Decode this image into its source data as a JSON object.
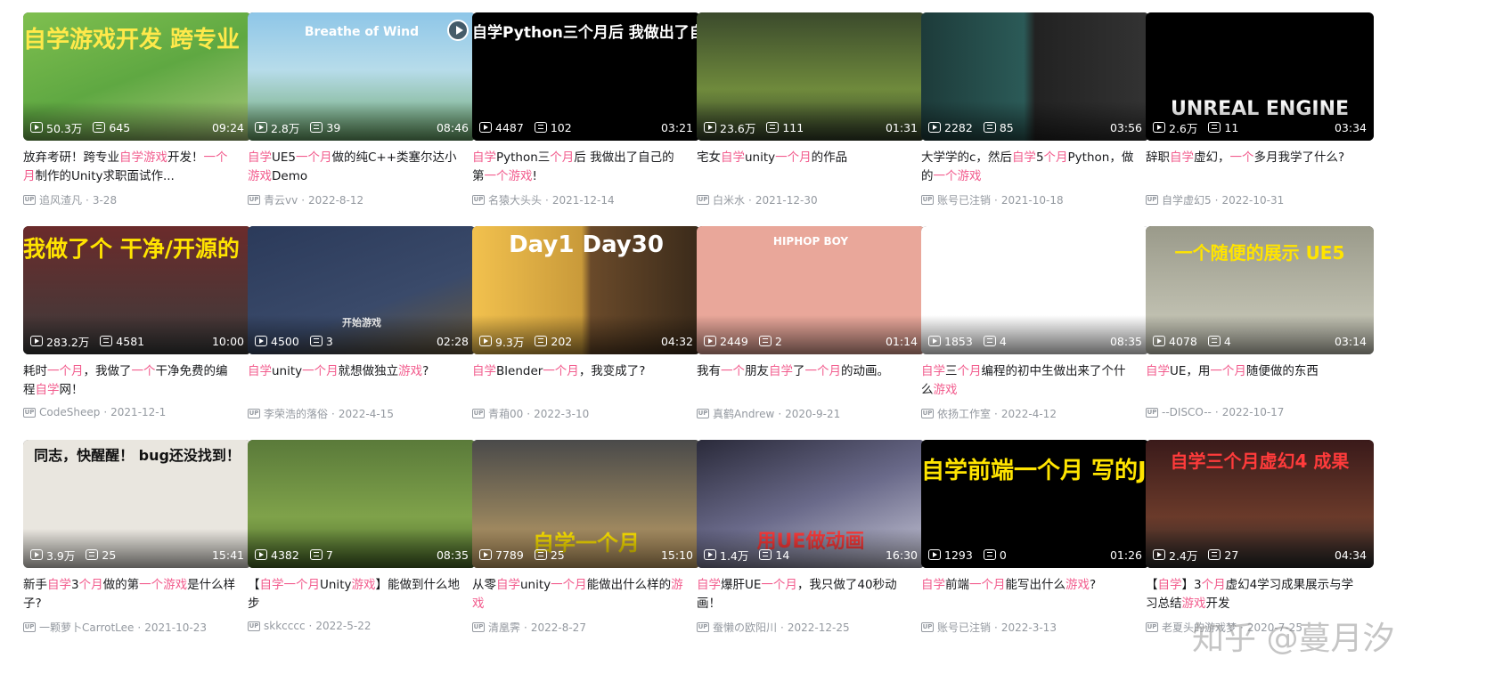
{
  "colors": {
    "highlight": "#f25d8e",
    "meta": "#9499a0",
    "title": "#18191c"
  },
  "icons": {
    "views": "play-count-icon",
    "danmaku": "danmaku-count-icon",
    "uploader": "up-badge-icon",
    "corner": "play-circle-icon"
  },
  "up_badge": "UP",
  "watermark": "知乎 @蔓月汐",
  "videos": [
    {
      "thumb_text": "自学游戏开发 跨专业 求职作品",
      "views": "50.3万",
      "danmaku": "645",
      "duration": "09:24",
      "title": [
        {
          "t": "放弃考研！跨专业"
        },
        {
          "t": "自学游戏",
          "hl": true
        },
        {
          "t": "开发！"
        },
        {
          "t": "一个月",
          "hl": true
        },
        {
          "t": "制作的Unity求职面试作..."
        }
      ],
      "uploader": "追风渣凡",
      "date": "3-28"
    },
    {
      "thumb_text": "Breathe of Wind",
      "views": "2.8万",
      "danmaku": "39",
      "duration": "08:46",
      "title": [
        {
          "t": "自学",
          "hl": true
        },
        {
          "t": "UE5"
        },
        {
          "t": "一个月",
          "hl": true
        },
        {
          "t": "做的纯C++类塞尔达小"
        },
        {
          "t": "游戏",
          "hl": true
        },
        {
          "t": "Demo"
        }
      ],
      "uploader": "青云vv",
      "date": "2022-8-12"
    },
    {
      "thumb_text": "自学Python三个月后 我做出了自己的第一个游戏",
      "views": "4487",
      "danmaku": "102",
      "duration": "03:21",
      "title": [
        {
          "t": "自学",
          "hl": true
        },
        {
          "t": "Python三"
        },
        {
          "t": "个月",
          "hl": true
        },
        {
          "t": "后 我做出了自己的第"
        },
        {
          "t": "一个游戏",
          "hl": true
        },
        {
          "t": "!"
        }
      ],
      "uploader": "名猿大头头",
      "date": "2021-12-14"
    },
    {
      "thumb_text": "",
      "views": "23.6万",
      "danmaku": "111",
      "duration": "01:31",
      "title": [
        {
          "t": "宅女"
        },
        {
          "t": "自学",
          "hl": true
        },
        {
          "t": "unity"
        },
        {
          "t": "一个月",
          "hl": true
        },
        {
          "t": "的作品"
        }
      ],
      "uploader": "白米水",
      "date": "2021-12-30"
    },
    {
      "thumb_text": "",
      "views": "2282",
      "danmaku": "85",
      "duration": "03:56",
      "title": [
        {
          "t": "大学学的c，然后"
        },
        {
          "t": "自学",
          "hl": true
        },
        {
          "t": "5"
        },
        {
          "t": "个月",
          "hl": true
        },
        {
          "t": "Python，做的"
        },
        {
          "t": "一个游戏",
          "hl": true
        }
      ],
      "uploader": "账号已注销",
      "date": "2021-10-18"
    },
    {
      "thumb_text": "UNREAL ENGINE",
      "views": "2.6万",
      "danmaku": "11",
      "duration": "03:34",
      "title": [
        {
          "t": "辞职"
        },
        {
          "t": "自学",
          "hl": true
        },
        {
          "t": "虚幻，"
        },
        {
          "t": "一个",
          "hl": true
        },
        {
          "t": "多月我学了什么?"
        }
      ],
      "uploader": "自学虚幻5",
      "date": "2022-10-31"
    },
    {
      "thumb_text": "我做了个 干净/开源的 编程自学网",
      "views": "283.2万",
      "danmaku": "4581",
      "duration": "10:00",
      "title": [
        {
          "t": "耗时"
        },
        {
          "t": "一个月",
          "hl": true
        },
        {
          "t": "，我做了"
        },
        {
          "t": "一个",
          "hl": true
        },
        {
          "t": "干净免费的编程"
        },
        {
          "t": "自学",
          "hl": true
        },
        {
          "t": "网！"
        }
      ],
      "uploader": "CodeSheep",
      "date": "2021-12-1"
    },
    {
      "thumb_text": "开始游戏",
      "views": "4500",
      "danmaku": "3",
      "duration": "02:28",
      "title": [
        {
          "t": "自学",
          "hl": true
        },
        {
          "t": "unity"
        },
        {
          "t": "一个月",
          "hl": true
        },
        {
          "t": "就想做独立"
        },
        {
          "t": "游戏",
          "hl": true
        },
        {
          "t": "?"
        }
      ],
      "uploader": "李荣浩的落俗",
      "date": "2022-4-15"
    },
    {
      "thumb_text": "Day1 Day30",
      "views": "9.3万",
      "danmaku": "202",
      "duration": "04:32",
      "title": [
        {
          "t": "自学",
          "hl": true
        },
        {
          "t": "Blender"
        },
        {
          "t": "一个月",
          "hl": true
        },
        {
          "t": "，我变成了?"
        }
      ],
      "uploader": "青葙00",
      "date": "2022-3-10"
    },
    {
      "thumb_text": "HIPHOP BOY",
      "views": "2449",
      "danmaku": "2",
      "duration": "01:14",
      "title": [
        {
          "t": "我有"
        },
        {
          "t": "一个",
          "hl": true
        },
        {
          "t": "朋友"
        },
        {
          "t": "自学",
          "hl": true
        },
        {
          "t": "了"
        },
        {
          "t": "一个月",
          "hl": true
        },
        {
          "t": "的动画。"
        }
      ],
      "uploader": "真鹤Andrew",
      "date": "2020-9-21"
    },
    {
      "thumb_text": "",
      "views": "1853",
      "danmaku": "4",
      "duration": "08:35",
      "title": [
        {
          "t": "自学",
          "hl": true
        },
        {
          "t": "三"
        },
        {
          "t": "个月",
          "hl": true
        },
        {
          "t": "编程的初中生做出来了个什么"
        },
        {
          "t": "游戏",
          "hl": true
        }
      ],
      "uploader": "依扬工作室",
      "date": "2022-4-12"
    },
    {
      "thumb_text": "一个随便的展示 UE5",
      "views": "4078",
      "danmaku": "4",
      "duration": "03:14",
      "title": [
        {
          "t": "自学",
          "hl": true
        },
        {
          "t": "UE，用"
        },
        {
          "t": "一个月",
          "hl": true
        },
        {
          "t": "随便做的东西"
        }
      ],
      "uploader": "--DISCO--",
      "date": "2022-10-17"
    },
    {
      "thumb_text": "同志，快醒醒！ bug还没找到！",
      "views": "3.9万",
      "danmaku": "25",
      "duration": "15:41",
      "title": [
        {
          "t": "新手"
        },
        {
          "t": "自学",
          "hl": true
        },
        {
          "t": "3"
        },
        {
          "t": "个月",
          "hl": true
        },
        {
          "t": "做的第"
        },
        {
          "t": "一个游戏",
          "hl": true
        },
        {
          "t": "是什么样子?"
        }
      ],
      "uploader": "一颗萝卜CarrotLee",
      "date": "2021-10-23"
    },
    {
      "thumb_text": "",
      "views": "4382",
      "danmaku": "7",
      "duration": "08:35",
      "title": [
        {
          "t": "【"
        },
        {
          "t": "自学一个月",
          "hl": true
        },
        {
          "t": "Unity"
        },
        {
          "t": "游戏",
          "hl": true
        },
        {
          "t": "】能做到什么地步"
        }
      ],
      "uploader": "skkcccc",
      "date": "2022-5-22"
    },
    {
      "thumb_text": "自学一个月",
      "views": "7789",
      "danmaku": "25",
      "duration": "15:10",
      "title": [
        {
          "t": "从零"
        },
        {
          "t": "自学",
          "hl": true
        },
        {
          "t": "unity"
        },
        {
          "t": "一个月",
          "hl": true
        },
        {
          "t": "能做出什么样的"
        },
        {
          "t": "游戏",
          "hl": true
        }
      ],
      "uploader": "清凰霁",
      "date": "2022-8-27"
    },
    {
      "thumb_text": "用UE做动画",
      "views": "1.4万",
      "danmaku": "14",
      "duration": "16:30",
      "title": [
        {
          "t": "自学",
          "hl": true
        },
        {
          "t": "爆肝UE"
        },
        {
          "t": "一个月",
          "hl": true
        },
        {
          "t": "，我只做了40秒动画！"
        }
      ],
      "uploader": "蚕懒の欧阳川",
      "date": "2022-12-25"
    },
    {
      "thumb_text": "自学前端一个月 写的JS游戏",
      "views": "1293",
      "danmaku": "0",
      "duration": "01:26",
      "title": [
        {
          "t": "自学",
          "hl": true
        },
        {
          "t": "前端"
        },
        {
          "t": "一个月",
          "hl": true
        },
        {
          "t": "能写出什么"
        },
        {
          "t": "游戏",
          "hl": true
        },
        {
          "t": "?"
        }
      ],
      "uploader": "账号已注销",
      "date": "2022-3-13"
    },
    {
      "thumb_text": "自学三个月虚幻4 成果",
      "views": "2.4万",
      "danmaku": "27",
      "duration": "04:34",
      "title": [
        {
          "t": "【"
        },
        {
          "t": "自学",
          "hl": true
        },
        {
          "t": "】"
        },
        {
          "t": "3"
        },
        {
          "t": "个月",
          "hl": true
        },
        {
          "t": "虚幻4学习成果展示与学习总结"
        },
        {
          "t": "游戏",
          "hl": true
        },
        {
          "t": "开发"
        }
      ],
      "uploader": "老夏头的游戏梦",
      "date": "2020-7-25"
    }
  ]
}
